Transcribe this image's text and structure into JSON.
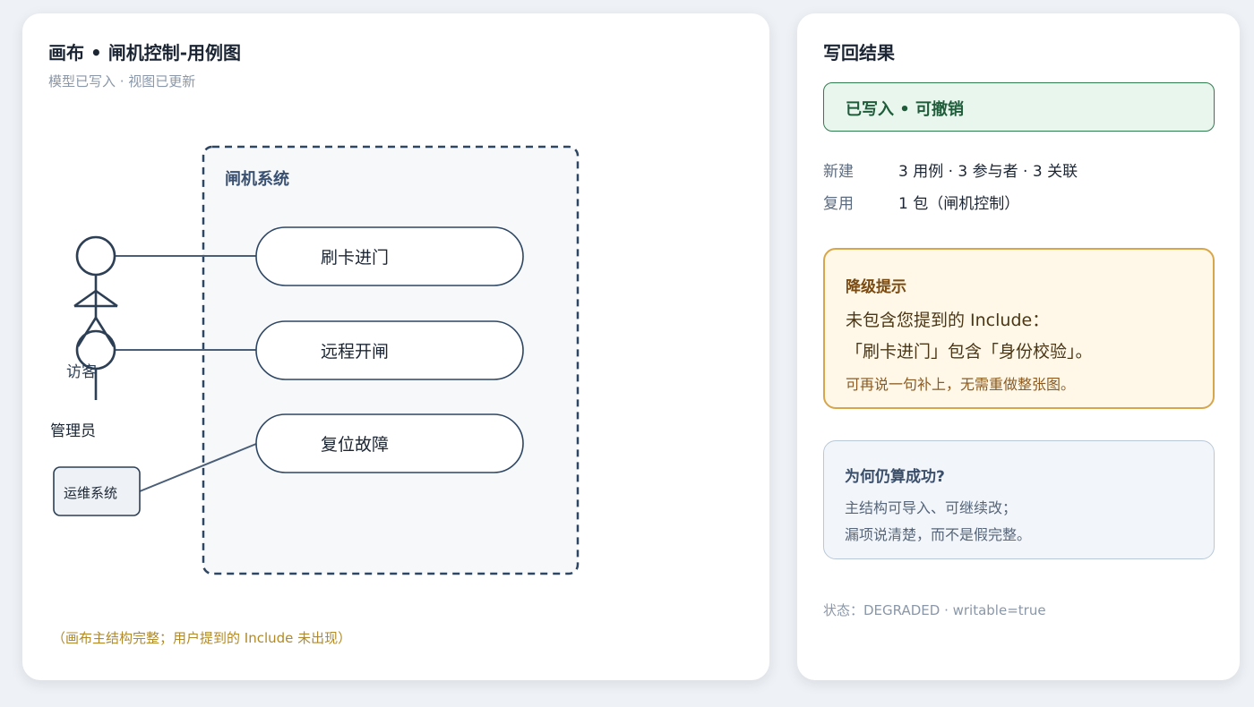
{
  "canvas": {
    "title": "画布 • 闸机控制-用例图",
    "subtitle": "模型已写入 · 视图已更新",
    "system_boundary_label": "闸机系统",
    "use_cases": [
      "刷卡进门",
      "远程开闸",
      "复位故障"
    ],
    "actors": {
      "visitor": "访客",
      "admin": "管理员",
      "system": "运维系统"
    },
    "footnote": "（画布主结构完整；用户提到的 Include 未出现）"
  },
  "result": {
    "title": "写回结果",
    "badge": "已写入 • 可撤销",
    "rows": [
      {
        "key": "新建",
        "value": "3 用例 · 3 参与者 · 3 关联"
      },
      {
        "key": "复用",
        "value": "1 包（闸机控制）"
      }
    ],
    "warning": {
      "title": "降级提示",
      "line1": "未包含您提到的 Include：",
      "line2": "「刷卡进门」包含「身份校验」。",
      "hint": "可再说一句补上，无需重做整张图。"
    },
    "why": {
      "title": "为何仍算成功?",
      "line1": "主结构可导入、可继续改；",
      "line2": "漏项说清楚，而不是假完整。"
    },
    "status": "状态：DEGRADED · writable=true"
  },
  "colors": {
    "success_border": "#2f7d4f",
    "success_bg": "#e9f6ee",
    "warning_border": "#d8a64a",
    "warning_bg": "#fff8e9",
    "diagram_stroke": "#2d4663"
  }
}
